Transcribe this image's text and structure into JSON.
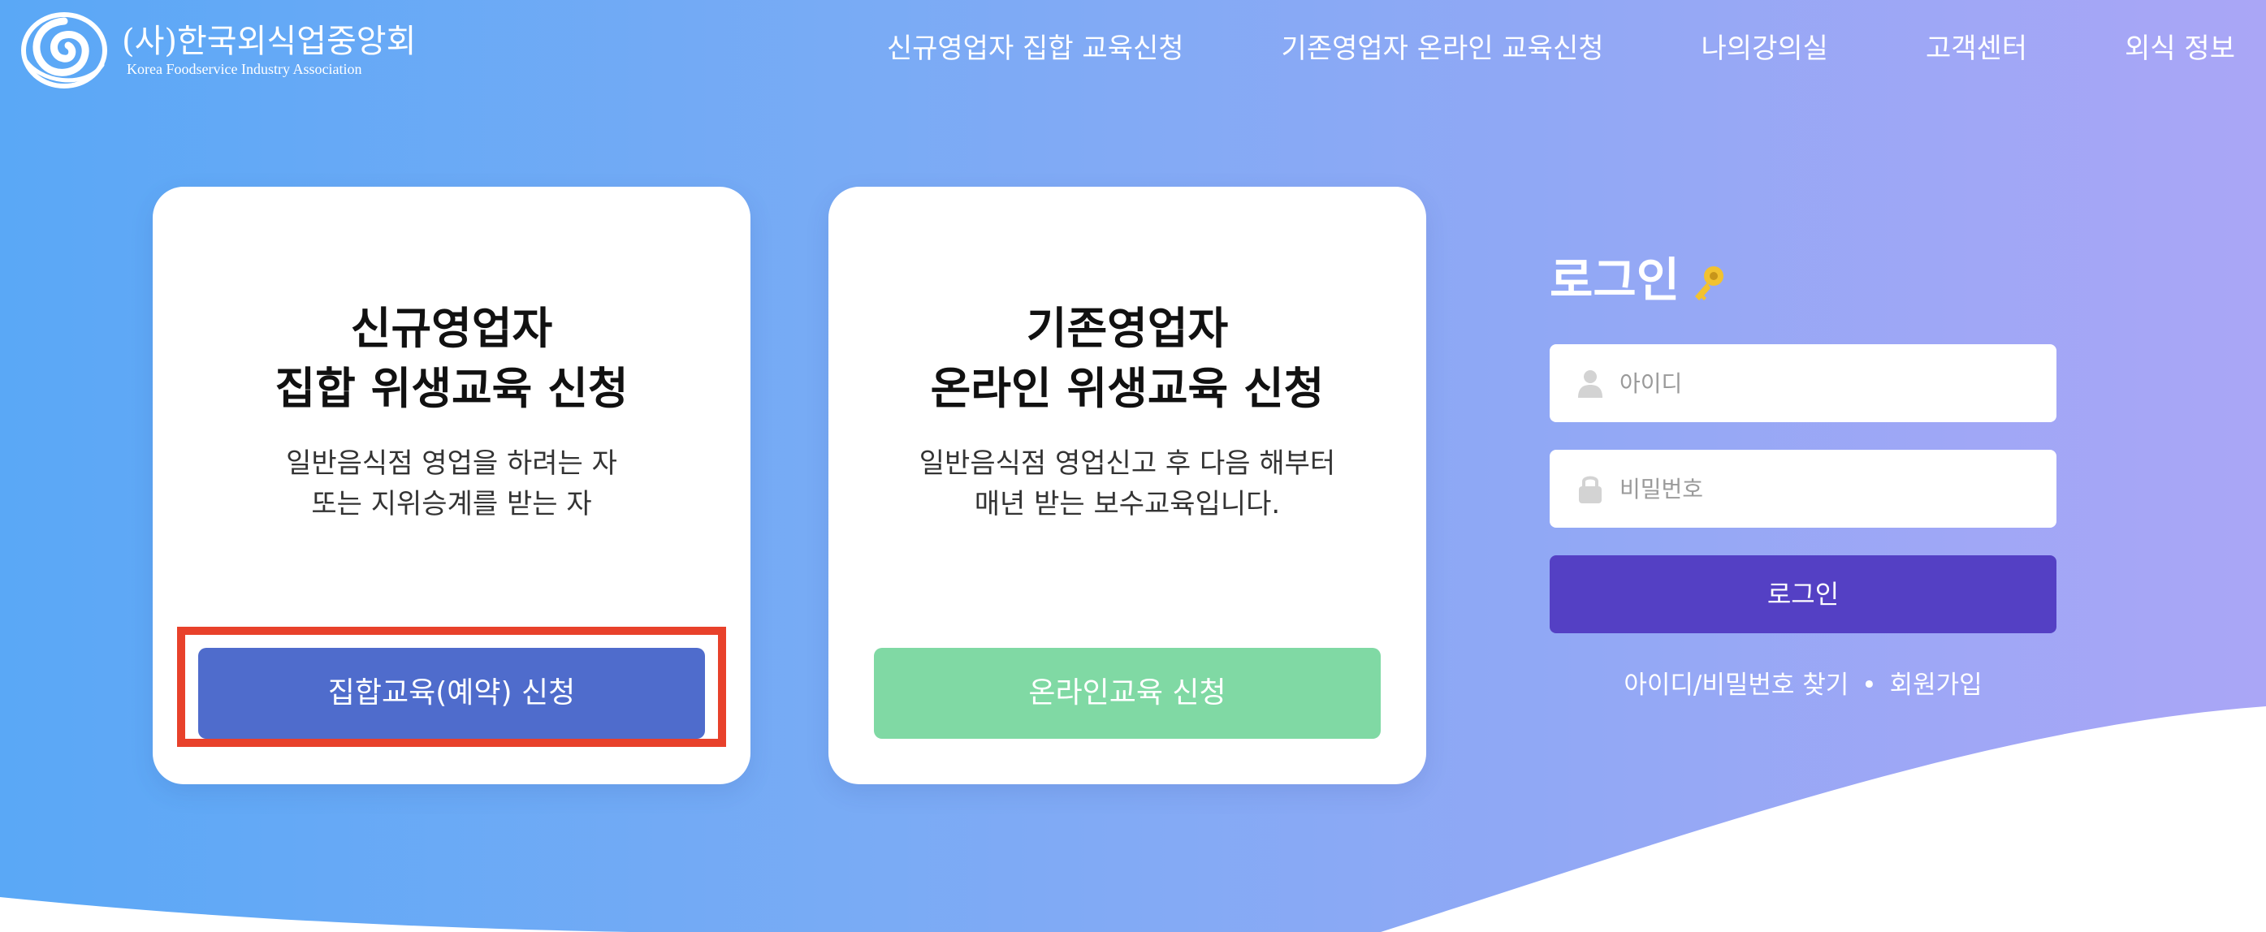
{
  "header": {
    "logo_korean": "(사)한국외식업중앙회",
    "logo_english": "Korea Foodservice Industry Association",
    "nav": [
      "신규영업자 집합 교육신청",
      "기존영업자 온라인 교육신청",
      "나의강의실",
      "고객센터",
      "외식 정보"
    ]
  },
  "cards": [
    {
      "title_line1": "신규영업자",
      "title_line2": "집합 위생교육 신청",
      "desc_line1": "일반음식점 영업을 하려는 자",
      "desc_line2": "또는 지위승계를 받는 자",
      "button_label": "집합교육(예약) 신청",
      "button_color": "#4f6ccc"
    },
    {
      "title_line1": "기존영업자",
      "title_line2": "온라인 위생교육 신청",
      "desc_line1": "일반음식점 영업신고 후 다음 해부터",
      "desc_line2": "매년 받는 보수교육입니다.",
      "button_label": "온라인교육 신청",
      "button_color": "#80d9a4"
    }
  ],
  "login": {
    "title": "로그인",
    "title_icon": "key-icon",
    "id_placeholder": "아이디",
    "id_icon": "user-icon",
    "password_placeholder": "비밀번호",
    "password_icon": "lock-icon",
    "button_label": "로그인",
    "button_color": "#5440c4",
    "find_label": "아이디/비밀번호 찾기",
    "separator": "•",
    "signup_label": "회원가입"
  },
  "colors": {
    "highlight": "#e8412b",
    "background_start": "#5aa8f6",
    "background_end": "#aaa6f6"
  }
}
